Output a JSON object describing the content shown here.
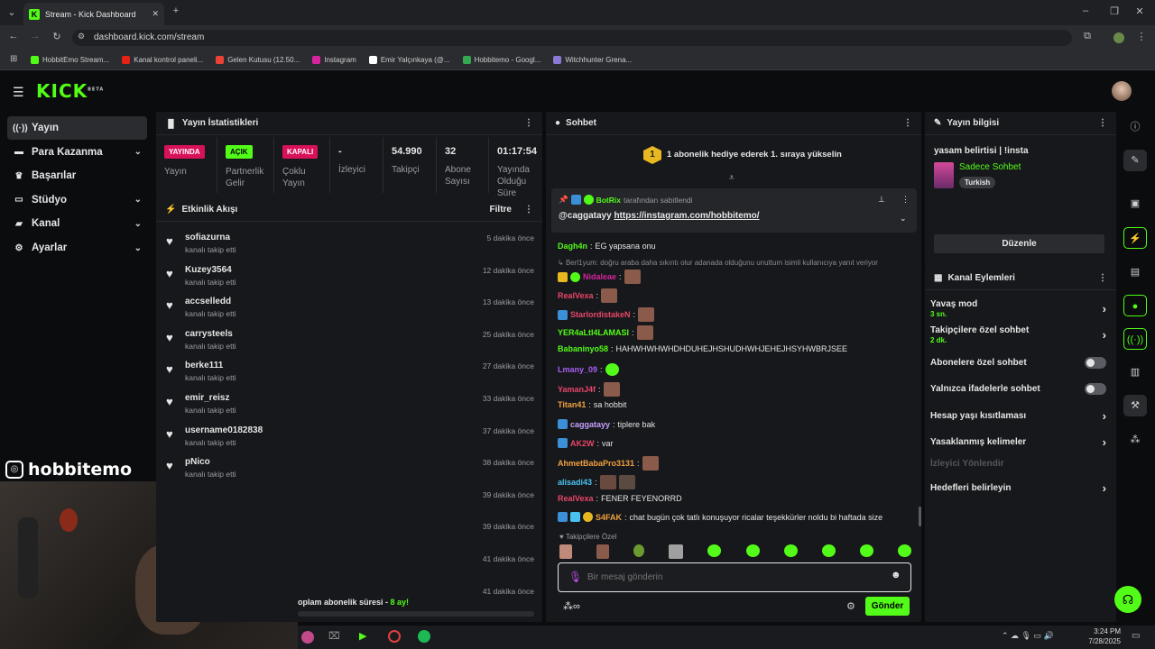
{
  "browser": {
    "tab_title": "Stream - Kick Dashboard",
    "url": "dashboard.kick.com/stream",
    "bookmarks": [
      {
        "label": "HobbitEmo Stream...",
        "color": "#53fc18"
      },
      {
        "label": "Kanal kontrol paneli...",
        "color": "#e62117"
      },
      {
        "label": "Gelen Kutusu (12.50...",
        "color": "#ea4335"
      },
      {
        "label": "Instagram",
        "color": "#d6249f"
      },
      {
        "label": "Emir Yalçınkaya (@...",
        "color": "#ffffff"
      },
      {
        "label": "Hobbitemo - Googl...",
        "color": "#34a853"
      },
      {
        "label": "Witchhunter Grena...",
        "color": "#8a7ad6"
      }
    ]
  },
  "app": {
    "logo": "KICK",
    "logo_sup": "BETA",
    "accent": "#53fc18"
  },
  "sidebar": {
    "items": [
      {
        "label": "Yayın",
        "icon": "broadcast-icon"
      },
      {
        "label": "Para Kazanma",
        "icon": "money-icon"
      },
      {
        "label": "Başarılar",
        "icon": "trophy-icon"
      },
      {
        "label": "Stüdyo",
        "icon": "studio-icon"
      },
      {
        "label": "Kanal",
        "icon": "channel-icon"
      },
      {
        "label": "Ayarlar",
        "icon": "gear-icon"
      }
    ],
    "overlay_name": "hobbitemo"
  },
  "stats": {
    "title": "Yayın İstatistikleri",
    "cells": [
      {
        "badge": "YAYINDA",
        "badge_color": "#d7125a",
        "label": "Yayın"
      },
      {
        "badge": "AÇIK",
        "badge_color": "#53fc18",
        "label": "Partnerlik Gelir"
      },
      {
        "badge": "KAPALI",
        "badge_color": "#d7125a",
        "label": "Çoklu Yayın"
      },
      {
        "value": "-",
        "label": "İzleyici"
      },
      {
        "value": "54.990",
        "label": "Takipçi"
      },
      {
        "value": "32",
        "label": "Abone Sayısı"
      },
      {
        "value": "01:17:54",
        "label": "Yayında Olduğu Süre"
      }
    ]
  },
  "activity": {
    "title": "Etkinlik Akışı",
    "filter": "Filtre",
    "items": [
      {
        "name": "sofiazurna",
        "sub": "kanalı takip etti",
        "time": "5 dakika önce"
      },
      {
        "name": "Kuzey3564",
        "sub": "kanalı takip etti",
        "time": "12 dakika önce"
      },
      {
        "name": "accselledd",
        "sub": "kanalı takip etti",
        "time": "13 dakika önce"
      },
      {
        "name": "carrysteels",
        "sub": "kanalı takip etti",
        "time": "25 dakika önce"
      },
      {
        "name": "berke111",
        "sub": "kanalı takip etti",
        "time": "27 dakika önce"
      },
      {
        "name": "emir_reisz",
        "sub": "kanalı takip etti",
        "time": "33 dakika önce"
      },
      {
        "name": "username0182838",
        "sub": "kanalı takip etti",
        "time": "37 dakika önce"
      },
      {
        "name": "pNico",
        "sub": "kanalı takip etti",
        "time": "38 dakika önce"
      },
      {
        "name": "",
        "sub": "",
        "time": "39 dakika önce"
      },
      {
        "name": "",
        "sub": "",
        "time": "39 dakika önce"
      },
      {
        "name": "",
        "sub": "",
        "time": "41 dakika önce"
      },
      {
        "name": "",
        "sub": "",
        "time": "41 dakika önce"
      }
    ],
    "footer_a": "oplam abonelik süresi - ",
    "footer_b": "8 ay!"
  },
  "chat": {
    "title": "Sohbet",
    "gift_banner_count": "1",
    "gift_banner": "1 abonelik hediye ederek 1. sıraya yükselin",
    "pinned_by": "BotRix",
    "pinned_by_suffix": "tarafından sabitlendi",
    "pinned_user": "@caggatayy",
    "pinned_link": "https://instagram.com/hobbitemo/",
    "messages": [
      {
        "user": "Dagh4n",
        "color": "#53fc18",
        "text": "EG yapsana onu"
      },
      {
        "user": "Nidaleae",
        "color": "#d6249f",
        "text": ""
      },
      {
        "user": "RealVexa",
        "color": "#e8466a",
        "text": ""
      },
      {
        "user": "StarlordistakeN",
        "color": "#e8466a",
        "text": ""
      },
      {
        "user": "YER4aLtI4LAMASI",
        "color": "#53fc18",
        "text": ""
      },
      {
        "user": "Babaninyo58",
        "color": "#53fc18",
        "text": "HAHWHWHWHDHDUHEJHSHUDHWHJEHEJHSYHWBRJSEE"
      },
      {
        "user": "Lmany_09",
        "color": "#a560f0",
        "text": ""
      },
      {
        "user": "YamanJ4f",
        "color": "#e8466a",
        "text": ""
      },
      {
        "user": "Titan41",
        "color": "#f0a040",
        "text": "sa hobbit"
      },
      {
        "user": "caggatayy",
        "color": "#c7a0ff",
        "text": "tiplere bak"
      },
      {
        "user": "AK2W",
        "color": "#e8466a",
        "text": "var"
      },
      {
        "user": "AhmetBabaPro3131",
        "color": "#f0a040",
        "text": ""
      },
      {
        "user": "alisadi43",
        "color": "#4ac0f0",
        "text": ""
      },
      {
        "user": "RealVexa",
        "color": "#e8466a",
        "text": "FENER FEYENORRD"
      },
      {
        "user": "S4FAK",
        "color": "#f0a040",
        "text": "chat bugün çok tatlı konuşuyor ricalar teşekkürler noldu bi haftada size"
      }
    ],
    "reply_user": "Berl1yum",
    "reply_text": "doğru araba daha sıkıntı olur adanada olduğunu unuttum isimli kullanıcıya yanıt veriyor",
    "followers_label": "Takipçilere Özel",
    "input_placeholder": "Bir mesaj gönderin",
    "send_label": "Gönder"
  },
  "info": {
    "title": "Yayın bilgisi",
    "stream_title": "yasam belirtisi | !insta",
    "category": "Sadece Sohbet",
    "tag": "Turkish",
    "edit_label": "Düzenle"
  },
  "actions": {
    "title": "Kanal Eylemleri",
    "items": [
      {
        "label": "Yavaş mod",
        "sub": "3 sn.",
        "kind": "chevron"
      },
      {
        "label": "Takipçilere özel sohbet",
        "sub": "2 dk.",
        "kind": "chevron"
      },
      {
        "label": "Abonelere özel sohbet",
        "sub": "",
        "kind": "toggle"
      },
      {
        "label": "Yalnızca ifadelerle sohbet",
        "sub": "",
        "kind": "toggle"
      },
      {
        "label": "Hesap yaşı kısıtlaması",
        "sub": "",
        "kind": "chevron"
      },
      {
        "label": "Yasaklanmış kelimeler",
        "sub": "",
        "kind": "chevron"
      },
      {
        "label": "İzleyici Yönlendir",
        "sub": "",
        "kind": "disabled"
      },
      {
        "label": "Hedefleri belirleyin",
        "sub": "",
        "kind": "chevron"
      }
    ]
  },
  "taskbar": {
    "time": "3:24 PM",
    "date": "7/28/2025"
  }
}
